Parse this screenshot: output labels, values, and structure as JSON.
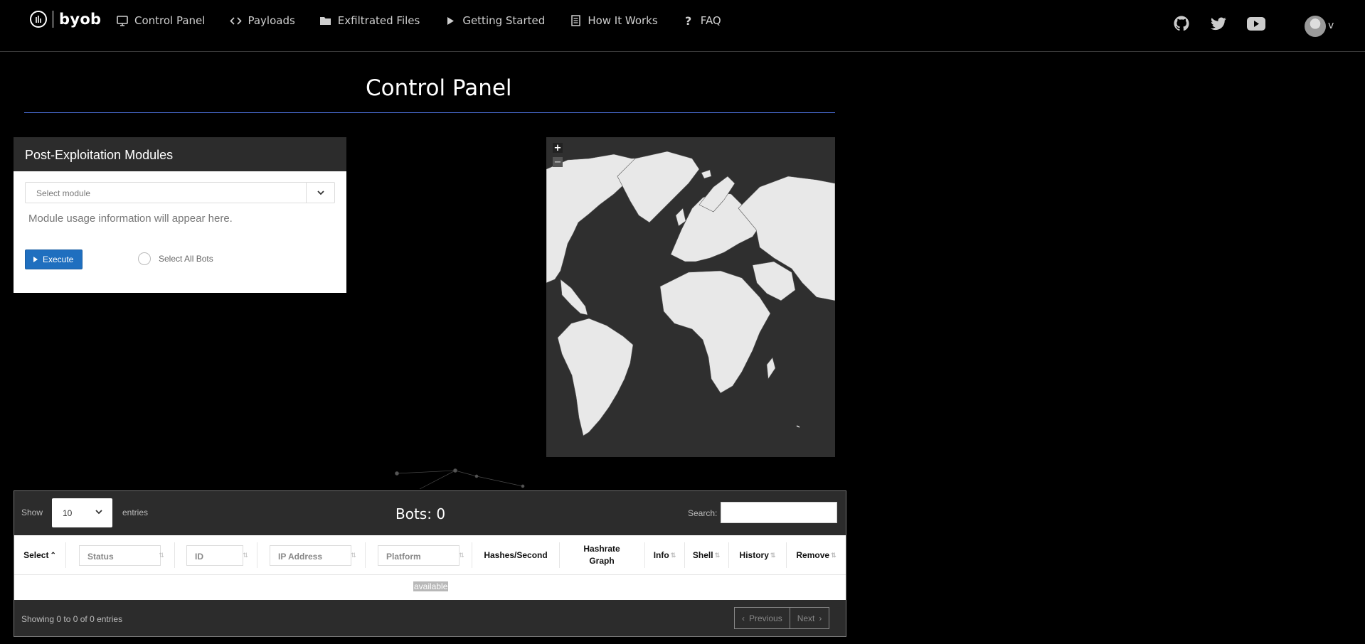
{
  "brand": {
    "name": "byob"
  },
  "nav": {
    "items": [
      {
        "label": "Control Panel",
        "icon": "monitor-icon"
      },
      {
        "label": "Payloads",
        "icon": "code-icon"
      },
      {
        "label": "Exfiltrated Files",
        "icon": "folder-icon"
      },
      {
        "label": "Getting Started",
        "icon": "play-icon"
      },
      {
        "label": "How It Works",
        "icon": "document-icon"
      },
      {
        "label": "FAQ",
        "icon": "question-icon"
      }
    ],
    "social": [
      "github-icon",
      "twitter-icon",
      "youtube-icon"
    ],
    "user_initial": "v"
  },
  "page": {
    "title": "Control Panel"
  },
  "modules_panel": {
    "title": "Post-Exploitation Modules",
    "select_placeholder": "Select module",
    "usage_text": "Module usage information will appear here.",
    "execute_label": "Execute",
    "select_all_label": "Select All Bots"
  },
  "map": {
    "zoom_in": "+",
    "zoom_out": "−"
  },
  "table": {
    "show_label": "Show",
    "page_length": "10",
    "entries_label": "entries",
    "bots_count": "Bots: 0",
    "search_label": "Search:",
    "columns": {
      "select": "Select",
      "status": "Status",
      "id": "ID",
      "ip": "IP Address",
      "platform": "Platform",
      "hashes": "Hashes/Second",
      "hashrate_graph_1": "Hashrate",
      "hashrate_graph_2": "Graph",
      "info": "Info",
      "shell": "Shell",
      "history": "History",
      "remove": "Remove"
    },
    "empty_message": "available",
    "info_text": "Showing 0 to 0 of 0 entries",
    "prev_label": "Previous",
    "next_label": "Next"
  },
  "colors": {
    "accent": "#1f6fbf",
    "rule": "#4a6dd6",
    "panel_header": "#2c2c2c"
  }
}
